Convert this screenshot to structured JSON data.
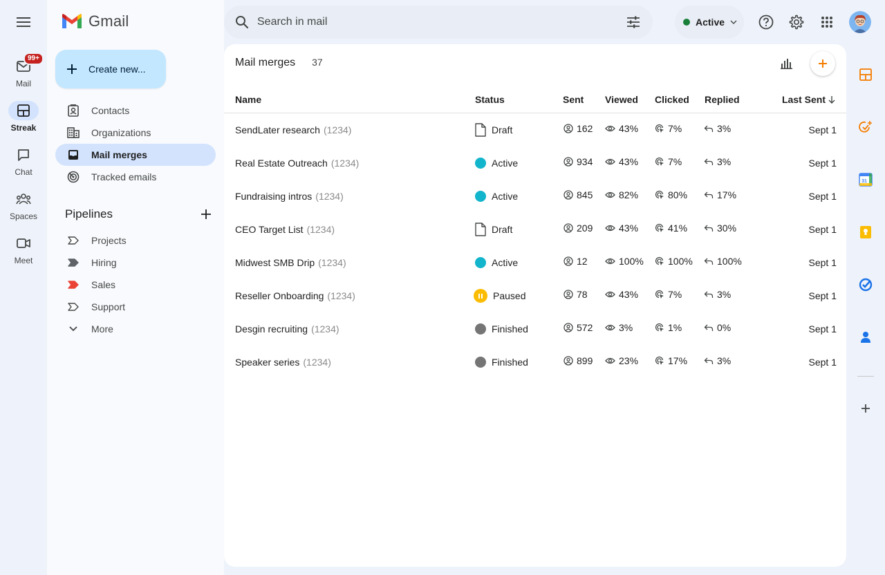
{
  "app": {
    "logo_text": "Gmail"
  },
  "rail": {
    "mail": {
      "label": "Mail",
      "badge": "99+"
    },
    "streak": {
      "label": "Streak"
    },
    "chat": {
      "label": "Chat"
    },
    "spaces": {
      "label": "Spaces"
    },
    "meet": {
      "label": "Meet"
    }
  },
  "sidebar": {
    "create_label": "Create new...",
    "nav": [
      {
        "label": "Contacts",
        "icon": "contacts-icon"
      },
      {
        "label": "Organizations",
        "icon": "organizations-icon"
      },
      {
        "label": "Mail merges",
        "icon": "mail-merges-icon"
      },
      {
        "label": "Tracked emails",
        "icon": "tracked-emails-icon"
      }
    ],
    "pipelines_title": "Pipelines",
    "pipelines": [
      {
        "label": "Projects",
        "color": "#ffffff"
      },
      {
        "label": "Hiring",
        "color": "#5f6368"
      },
      {
        "label": "Sales",
        "color": "#ea4335"
      },
      {
        "label": "Support",
        "color": "#ffffff"
      }
    ],
    "more_label": "More"
  },
  "search": {
    "placeholder": "Search in mail"
  },
  "status": {
    "label": "Active",
    "color": "#188038"
  },
  "main": {
    "title": "Mail merges",
    "count": "37",
    "columns": {
      "name": "Name",
      "status": "Status",
      "sent": "Sent",
      "viewed": "Viewed",
      "clicked": "Clicked",
      "replied": "Replied",
      "last_sent": "Last Sent"
    },
    "rows": [
      {
        "name": "SendLater research",
        "id": "(1234)",
        "status": "Draft",
        "sent": "162",
        "viewed": "43%",
        "clicked": "7%",
        "replied": "3%",
        "last_sent": "Sept 1"
      },
      {
        "name": "Real Estate Outreach",
        "id": "(1234)",
        "status": "Active",
        "sent": "934",
        "viewed": "43%",
        "clicked": "7%",
        "replied": "3%",
        "last_sent": "Sept 1"
      },
      {
        "name": "Fundraising intros",
        "id": "(1234)",
        "status": "Active",
        "sent": "845",
        "viewed": "82%",
        "clicked": "80%",
        "replied": "17%",
        "last_sent": "Sept 1"
      },
      {
        "name": "CEO Target List",
        "id": "(1234)",
        "status": "Draft",
        "sent": "209",
        "viewed": "43%",
        "clicked": "41%",
        "replied": "30%",
        "last_sent": "Sept 1"
      },
      {
        "name": "Midwest SMB Drip",
        "id": "(1234)",
        "status": "Active",
        "sent": "12",
        "viewed": "100%",
        "clicked": "100%",
        "replied": "100%",
        "last_sent": "Sept 1"
      },
      {
        "name": "Reseller Onboarding",
        "id": "(1234)",
        "status": "Paused",
        "sent": "78",
        "viewed": "43%",
        "clicked": "7%",
        "replied": "3%",
        "last_sent": "Sept 1"
      },
      {
        "name": "Desgin recruiting",
        "id": "(1234)",
        "status": "Finished",
        "sent": "572",
        "viewed": "3%",
        "clicked": "1%",
        "replied": "0%",
        "last_sent": "Sept 1"
      },
      {
        "name": "Speaker series",
        "id": "(1234)",
        "status": "Finished",
        "sent": "899",
        "viewed": "23%",
        "clicked": "17%",
        "replied": "3%",
        "last_sent": "Sept 1"
      }
    ]
  },
  "colors": {
    "active": "#12b5cb",
    "finished": "#757575",
    "paused": "#fbbc04",
    "accent": "#f57c00"
  }
}
